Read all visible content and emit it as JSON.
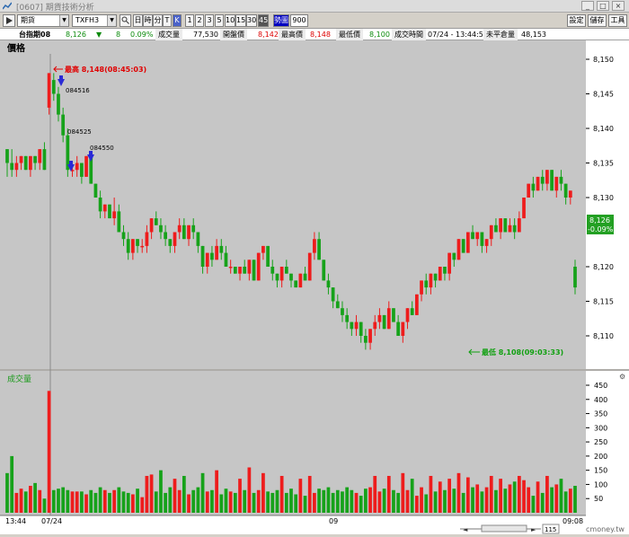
{
  "window": {
    "title": "[0607] 期貨技術分析",
    "controls": [
      "設定",
      "儲存",
      "工具"
    ]
  },
  "toolbar": {
    "category": "期貨",
    "symbol": "TXFH3",
    "buttons_a": [
      "日",
      "時",
      "分",
      "T"
    ],
    "highlight": "K",
    "intervals": [
      "1",
      "2",
      "3",
      "5",
      "10",
      "15",
      "30",
      "45"
    ],
    "mode_label": "勢圖",
    "mode_value": "900"
  },
  "quote": {
    "name": "台指期08",
    "price": "8,126",
    "change_arrow": "▼",
    "change": "8",
    "change_pct": "0.09%",
    "volume_label": "成交量",
    "volume": "77,530",
    "open_label": "開盤價",
    "open": "8,142",
    "high_label": "最高價",
    "high": "8,148",
    "low_label": "最低價",
    "low": "8,100",
    "time_label": "成交時間",
    "time": "07/24 - 13:44:59",
    "oi_label": "未平倉量",
    "oi": "48,153"
  },
  "price_panel": {
    "label": "價格",
    "y_ticks": [
      "8,150",
      "8,145",
      "8,140",
      "8,135",
      "8,130",
      "8,120",
      "8,115",
      "8,110"
    ],
    "current_price": "8,126",
    "current_change": "-0.09%",
    "high_note": "最高 8,148(08:45:03)",
    "low_note": "最低 8,108(09:03:33)",
    "marker_labels": [
      "084516",
      "084525",
      "084550"
    ]
  },
  "volume_panel": {
    "label": "成交量",
    "y_ticks": [
      "450",
      "400",
      "350",
      "300",
      "250",
      "200",
      "150",
      "100",
      "50"
    ]
  },
  "x_axis": {
    "labels": [
      "13:44",
      "07/24",
      "09",
      "09:08"
    ],
    "scroll_value": "115",
    "watermark": "cmoney.tw"
  },
  "colors": {
    "up": "#ee1c1c",
    "down": "#16a21a",
    "panel": "#c6c6c6",
    "high_note": "#e00000",
    "low_note": "#10a010",
    "marker": "#2a2ad6"
  },
  "chart_data": {
    "type": "candlestick",
    "series": [
      {
        "o": 8137,
        "h": 8137,
        "l": 8133,
        "c": 8135,
        "v": 140
      },
      {
        "o": 8135,
        "h": 8137,
        "l": 8133,
        "c": 8134,
        "v": 200
      },
      {
        "o": 8134,
        "h": 8136,
        "l": 8133,
        "c": 8135,
        "v": 70
      },
      {
        "o": 8135,
        "h": 8136,
        "l": 8134,
        "c": 8136,
        "v": 85
      },
      {
        "o": 8136,
        "h": 8136,
        "l": 8134,
        "c": 8134,
        "v": 75
      },
      {
        "o": 8134,
        "h": 8136,
        "l": 8133,
        "c": 8136,
        "v": 95
      },
      {
        "o": 8136,
        "h": 8136,
        "l": 8134,
        "c": 8135,
        "v": 105
      },
      {
        "o": 8135,
        "h": 8137,
        "l": 8134,
        "c": 8137,
        "v": 80
      },
      {
        "o": 8137,
        "h": 8138,
        "l": 8134,
        "c": 8134,
        "v": 50
      },
      {
        "o": 8143,
        "h": 8148,
        "l": 8142,
        "c": 8148,
        "v": 430
      },
      {
        "o": 8147,
        "h": 8148,
        "l": 8144,
        "c": 8145,
        "v": 80
      },
      {
        "o": 8145,
        "h": 8146,
        "l": 8141,
        "c": 8142,
        "v": 85
      },
      {
        "o": 8142,
        "h": 8143,
        "l": 8138,
        "c": 8139,
        "v": 90
      },
      {
        "o": 8139,
        "h": 8140,
        "l": 8133,
        "c": 8134,
        "v": 80
      },
      {
        "o": 8134,
        "h": 8135,
        "l": 8133,
        "c": 8134,
        "v": 75
      },
      {
        "o": 8134,
        "h": 8136,
        "l": 8133,
        "c": 8135,
        "v": 75
      },
      {
        "o": 8135,
        "h": 8135,
        "l": 8132,
        "c": 8133,
        "v": 75
      },
      {
        "o": 8133,
        "h": 8136,
        "l": 8133,
        "c": 8136,
        "v": 65
      },
      {
        "o": 8136,
        "h": 8136,
        "l": 8132,
        "c": 8132,
        "v": 80
      },
      {
        "o": 8132,
        "h": 8132,
        "l": 8130,
        "c": 8130,
        "v": 70
      },
      {
        "o": 8130,
        "h": 8131,
        "l": 8127,
        "c": 8128,
        "v": 90
      },
      {
        "o": 8128,
        "h": 8129,
        "l": 8127,
        "c": 8129,
        "v": 80
      },
      {
        "o": 8129,
        "h": 8129,
        "l": 8127,
        "c": 8127,
        "v": 70
      },
      {
        "o": 8127,
        "h": 8130,
        "l": 8126,
        "c": 8128,
        "v": 80
      },
      {
        "o": 8128,
        "h": 8129,
        "l": 8125,
        "c": 8125,
        "v": 90
      },
      {
        "o": 8125,
        "h": 8126,
        "l": 8123,
        "c": 8124,
        "v": 75
      },
      {
        "o": 8124,
        "h": 8125,
        "l": 8121,
        "c": 8122,
        "v": 70
      },
      {
        "o": 8122,
        "h": 8124,
        "l": 8121,
        "c": 8124,
        "v": 65
      },
      {
        "o": 8124,
        "h": 8124,
        "l": 8122,
        "c": 8123,
        "v": 85
      },
      {
        "o": 8123,
        "h": 8124,
        "l": 8122,
        "c": 8123,
        "v": 55
      },
      {
        "o": 8123,
        "h": 8126,
        "l": 8122,
        "c": 8125,
        "v": 130
      },
      {
        "o": 8125,
        "h": 8127,
        "l": 8124,
        "c": 8127,
        "v": 135
      },
      {
        "o": 8127,
        "h": 8128,
        "l": 8126,
        "c": 8126,
        "v": 75
      },
      {
        "o": 8126,
        "h": 8127,
        "l": 8124,
        "c": 8125,
        "v": 150
      },
      {
        "o": 8125,
        "h": 8126,
        "l": 8123,
        "c": 8124,
        "v": 70
      },
      {
        "o": 8124,
        "h": 8124,
        "l": 8122,
        "c": 8123,
        "v": 90
      },
      {
        "o": 8123,
        "h": 8125,
        "l": 8122,
        "c": 8125,
        "v": 120
      },
      {
        "o": 8125,
        "h": 8127,
        "l": 8124,
        "c": 8126,
        "v": 80
      },
      {
        "o": 8126,
        "h": 8127,
        "l": 8124,
        "c": 8124,
        "v": 130
      },
      {
        "o": 8124,
        "h": 8126,
        "l": 8123,
        "c": 8126,
        "v": 65
      },
      {
        "o": 8126,
        "h": 8127,
        "l": 8124,
        "c": 8125,
        "v": 80
      },
      {
        "o": 8125,
        "h": 8125,
        "l": 8122,
        "c": 8123,
        "v": 90
      },
      {
        "o": 8123,
        "h": 8123,
        "l": 8119,
        "c": 8120,
        "v": 140
      },
      {
        "o": 8120,
        "h": 8122,
        "l": 8119,
        "c": 8122,
        "v": 75
      },
      {
        "o": 8122,
        "h": 8123,
        "l": 8120,
        "c": 8121,
        "v": 80
      },
      {
        "o": 8121,
        "h": 8124,
        "l": 8121,
        "c": 8123,
        "v": 150
      },
      {
        "o": 8123,
        "h": 8124,
        "l": 8121,
        "c": 8122,
        "v": 65
      },
      {
        "o": 8122,
        "h": 8123,
        "l": 8120,
        "c": 8120,
        "v": 85
      },
      {
        "o": 8120,
        "h": 8121,
        "l": 8119,
        "c": 8120,
        "v": 75
      },
      {
        "o": 8120,
        "h": 8120,
        "l": 8119,
        "c": 8119,
        "v": 70
      },
      {
        "o": 8119,
        "h": 8120,
        "l": 8118,
        "c": 8120,
        "v": 120
      },
      {
        "o": 8120,
        "h": 8121,
        "l": 8119,
        "c": 8119,
        "v": 80
      },
      {
        "o": 8119,
        "h": 8121,
        "l": 8118,
        "c": 8121,
        "v": 160
      },
      {
        "o": 8121,
        "h": 8121,
        "l": 8118,
        "c": 8118,
        "v": 70
      },
      {
        "o": 8118,
        "h": 8122,
        "l": 8118,
        "c": 8122,
        "v": 80
      },
      {
        "o": 8122,
        "h": 8123,
        "l": 8121,
        "c": 8123,
        "v": 140
      },
      {
        "o": 8123,
        "h": 8123,
        "l": 8120,
        "c": 8120,
        "v": 75
      },
      {
        "o": 8120,
        "h": 8121,
        "l": 8118,
        "c": 8119,
        "v": 70
      },
      {
        "o": 8119,
        "h": 8119,
        "l": 8117,
        "c": 8118,
        "v": 80
      },
      {
        "o": 8118,
        "h": 8120,
        "l": 8117,
        "c": 8120,
        "v": 130
      },
      {
        "o": 8120,
        "h": 8121,
        "l": 8119,
        "c": 8119,
        "v": 70
      },
      {
        "o": 8119,
        "h": 8119,
        "l": 8117,
        "c": 8118,
        "v": 85
      },
      {
        "o": 8118,
        "h": 8118,
        "l": 8117,
        "c": 8117,
        "v": 65
      },
      {
        "o": 8117,
        "h": 8119,
        "l": 8117,
        "c": 8119,
        "v": 120
      },
      {
        "o": 8119,
        "h": 8120,
        "l": 8118,
        "c": 8118,
        "v": 60
      },
      {
        "o": 8118,
        "h": 8122,
        "l": 8118,
        "c": 8122,
        "v": 130
      },
      {
        "o": 8122,
        "h": 8125,
        "l": 8121,
        "c": 8124,
        "v": 70
      },
      {
        "o": 8124,
        "h": 8125,
        "l": 8121,
        "c": 8121,
        "v": 85
      },
      {
        "o": 8121,
        "h": 8121,
        "l": 8118,
        "c": 8118,
        "v": 80
      },
      {
        "o": 8118,
        "h": 8119,
        "l": 8116,
        "c": 8117,
        "v": 90
      },
      {
        "o": 8117,
        "h": 8117,
        "l": 8114,
        "c": 8115,
        "v": 70
      },
      {
        "o": 8115,
        "h": 8116,
        "l": 8114,
        "c": 8114,
        "v": 80
      },
      {
        "o": 8114,
        "h": 8115,
        "l": 8112,
        "c": 8113,
        "v": 75
      },
      {
        "o": 8113,
        "h": 8114,
        "l": 8111,
        "c": 8112,
        "v": 90
      },
      {
        "o": 8112,
        "h": 8112,
        "l": 8110,
        "c": 8111,
        "v": 80
      },
      {
        "o": 8111,
        "h": 8113,
        "l": 8110,
        "c": 8112,
        "v": 70
      },
      {
        "o": 8112,
        "h": 8112,
        "l": 8109,
        "c": 8110,
        "v": 60
      },
      {
        "o": 8110,
        "h": 8111,
        "l": 8108,
        "c": 8109,
        "v": 85
      },
      {
        "o": 8109,
        "h": 8111,
        "l": 8108,
        "c": 8111,
        "v": 90
      },
      {
        "o": 8111,
        "h": 8113,
        "l": 8110,
        "c": 8112,
        "v": 130
      },
      {
        "o": 8112,
        "h": 8114,
        "l": 8111,
        "c": 8113,
        "v": 75
      },
      {
        "o": 8113,
        "h": 8113,
        "l": 8111,
        "c": 8111,
        "v": 85
      },
      {
        "o": 8111,
        "h": 8115,
        "l": 8111,
        "c": 8114,
        "v": 130
      },
      {
        "o": 8114,
        "h": 8114,
        "l": 8112,
        "c": 8112,
        "v": 80
      },
      {
        "o": 8112,
        "h": 8113,
        "l": 8110,
        "c": 8110,
        "v": 70
      },
      {
        "o": 8110,
        "h": 8112,
        "l": 8109,
        "c": 8112,
        "v": 140
      },
      {
        "o": 8112,
        "h": 8114,
        "l": 8111,
        "c": 8114,
        "v": 80
      },
      {
        "o": 8114,
        "h": 8115,
        "l": 8113,
        "c": 8113,
        "v": 120
      },
      {
        "o": 8113,
        "h": 8116,
        "l": 8113,
        "c": 8116,
        "v": 60
      },
      {
        "o": 8116,
        "h": 8118,
        "l": 8115,
        "c": 8118,
        "v": 90
      },
      {
        "o": 8118,
        "h": 8119,
        "l": 8116,
        "c": 8117,
        "v": 65
      },
      {
        "o": 8117,
        "h": 8119,
        "l": 8116,
        "c": 8119,
        "v": 130
      },
      {
        "o": 8119,
        "h": 8119,
        "l": 8117,
        "c": 8118,
        "v": 75
      },
      {
        "o": 8118,
        "h": 8120,
        "l": 8118,
        "c": 8120,
        "v": 110
      },
      {
        "o": 8120,
        "h": 8120,
        "l": 8118,
        "c": 8119,
        "v": 80
      },
      {
        "o": 8119,
        "h": 8122,
        "l": 8118,
        "c": 8122,
        "v": 120
      },
      {
        "o": 8122,
        "h": 8122,
        "l": 8120,
        "c": 8121,
        "v": 85
      },
      {
        "o": 8121,
        "h": 8124,
        "l": 8121,
        "c": 8124,
        "v": 140
      },
      {
        "o": 8124,
        "h": 8124,
        "l": 8122,
        "c": 8122,
        "v": 70
      },
      {
        "o": 8122,
        "h": 8125,
        "l": 8122,
        "c": 8125,
        "v": 125
      },
      {
        "o": 8125,
        "h": 8126,
        "l": 8124,
        "c": 8124,
        "v": 90
      },
      {
        "o": 8124,
        "h": 8125,
        "l": 8123,
        "c": 8125,
        "v": 100
      },
      {
        "o": 8125,
        "h": 8125,
        "l": 8122,
        "c": 8123,
        "v": 75
      },
      {
        "o": 8123,
        "h": 8124,
        "l": 8122,
        "c": 8124,
        "v": 90
      },
      {
        "o": 8124,
        "h": 8126,
        "l": 8123,
        "c": 8126,
        "v": 130
      },
      {
        "o": 8126,
        "h": 8127,
        "l": 8125,
        "c": 8125,
        "v": 80
      },
      {
        "o": 8125,
        "h": 8127,
        "l": 8124,
        "c": 8127,
        "v": 120
      },
      {
        "o": 8127,
        "h": 8127,
        "l": 8125,
        "c": 8125,
        "v": 85
      },
      {
        "o": 8125,
        "h": 8127,
        "l": 8125,
        "c": 8126,
        "v": 100
      },
      {
        "o": 8126,
        "h": 8127,
        "l": 8124,
        "c": 8125,
        "v": 110
      },
      {
        "o": 8125,
        "h": 8128,
        "l": 8125,
        "c": 8127,
        "v": 130
      },
      {
        "o": 8127,
        "h": 8130,
        "l": 8127,
        "c": 8130,
        "v": 115
      },
      {
        "o": 8130,
        "h": 8132,
        "l": 8130,
        "c": 8132,
        "v": 90
      },
      {
        "o": 8132,
        "h": 8133,
        "l": 8130,
        "c": 8131,
        "v": 60
      },
      {
        "o": 8131,
        "h": 8133,
        "l": 8131,
        "c": 8133,
        "v": 110
      },
      {
        "o": 8133,
        "h": 8134,
        "l": 8131,
        "c": 8132,
        "v": 70
      },
      {
        "o": 8132,
        "h": 8134,
        "l": 8131,
        "c": 8134,
        "v": 130
      },
      {
        "o": 8134,
        "h": 8134,
        "l": 8131,
        "c": 8131,
        "v": 90
      },
      {
        "o": 8131,
        "h": 8133,
        "l": 8130,
        "c": 8133,
        "v": 100
      },
      {
        "o": 8133,
        "h": 8134,
        "l": 8131,
        "c": 8132,
        "v": 120
      },
      {
        "o": 8132,
        "h": 8132,
        "l": 8129,
        "c": 8130,
        "v": 75
      },
      {
        "o": 8130,
        "h": 8131,
        "l": 8129,
        "c": 8131,
        "v": 85
      },
      {
        "o": 8120,
        "h": 8121,
        "l": 8116,
        "c": 8117,
        "v": 95
      }
    ]
  }
}
